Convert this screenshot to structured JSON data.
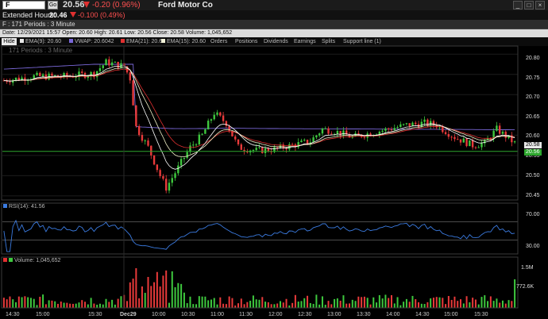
{
  "header": {
    "symbol": "F",
    "go_label": "Go",
    "price": "20.56",
    "change": "-0.20 (0.96%)",
    "company": "Ford Motor Co",
    "window_buttons": [
      "_",
      "□",
      "×"
    ]
  },
  "extended": {
    "label": "Extended Hours:",
    "price": "20.46",
    "change": "-0.100 (0.49%)"
  },
  "chart_title": "F : 171 Periods : 3 Minute",
  "ohlc_line": "Date: 12/29/2021 15:57  Open: 20.60  High: 20.61  Low: 20.56  Close: 20.58  Volume: 1,045,652",
  "toolbar": {
    "hide_label": "Hide",
    "legend": [
      {
        "label": "EMA(9): 20.60",
        "color": "#e8e8e8"
      },
      {
        "label": "VWAP: 20.6042",
        "color": "#7a68d8"
      },
      {
        "label": "EMA(21): 20.60",
        "color": "#e03030"
      },
      {
        "label": "EMA(15): 20.60",
        "color": "#f2f2d8"
      }
    ],
    "tabs": [
      "Orders",
      "Positions",
      "Dividends",
      "Earnings",
      "Splits",
      "Support line (1)"
    ]
  },
  "watermark": "171  Periods : 3 Minute",
  "price_axis": {
    "ticks": [
      "20.80",
      "20.75",
      "20.70",
      "20.65",
      "20.60",
      "20.55",
      "20.50",
      "20.45"
    ],
    "last_label": "20.58",
    "support_label": "20.56"
  },
  "rsi": {
    "header": "RSI(14): 41.56",
    "ticks": [
      "70.00",
      "30.00"
    ]
  },
  "volume": {
    "header": "Volume: 1,045,652",
    "ticks": [
      "1.5M",
      "772.6K"
    ]
  },
  "time_axis": [
    "14:30",
    "15:00",
    "15:30",
    "Dec29",
    "10:00",
    "10:30",
    "11:00",
    "11:30",
    "12:00",
    "12:30",
    "13:00",
    "13:30",
    "14:00",
    "14:30",
    "15:00",
    "15:30"
  ],
  "colors": {
    "up": "#3ec83e",
    "down": "#e83a3a",
    "vwap": "#7a68d8",
    "ema9": "#ffffff",
    "ema15": "#f2f2c8",
    "ema21": "#e03030",
    "support": "#2ea82e",
    "rsi": "#3b7be0"
  },
  "chart_data": {
    "type": "candlestick",
    "y_range": [
      20.44,
      20.82
    ],
    "support_level": 20.56,
    "time_labels": [
      "14:30",
      "15:00",
      "15:30",
      "Dec29",
      "10:00",
      "10:30",
      "11:00",
      "11:30",
      "12:00",
      "12:30",
      "13:00",
      "13:30",
      "14:00",
      "14:30",
      "15:00",
      "15:30"
    ],
    "rsi_range": [
      0,
      100
    ],
    "rsi_levels": [
      70,
      30
    ],
    "volume_ticks": [
      1500000,
      772600
    ]
  }
}
